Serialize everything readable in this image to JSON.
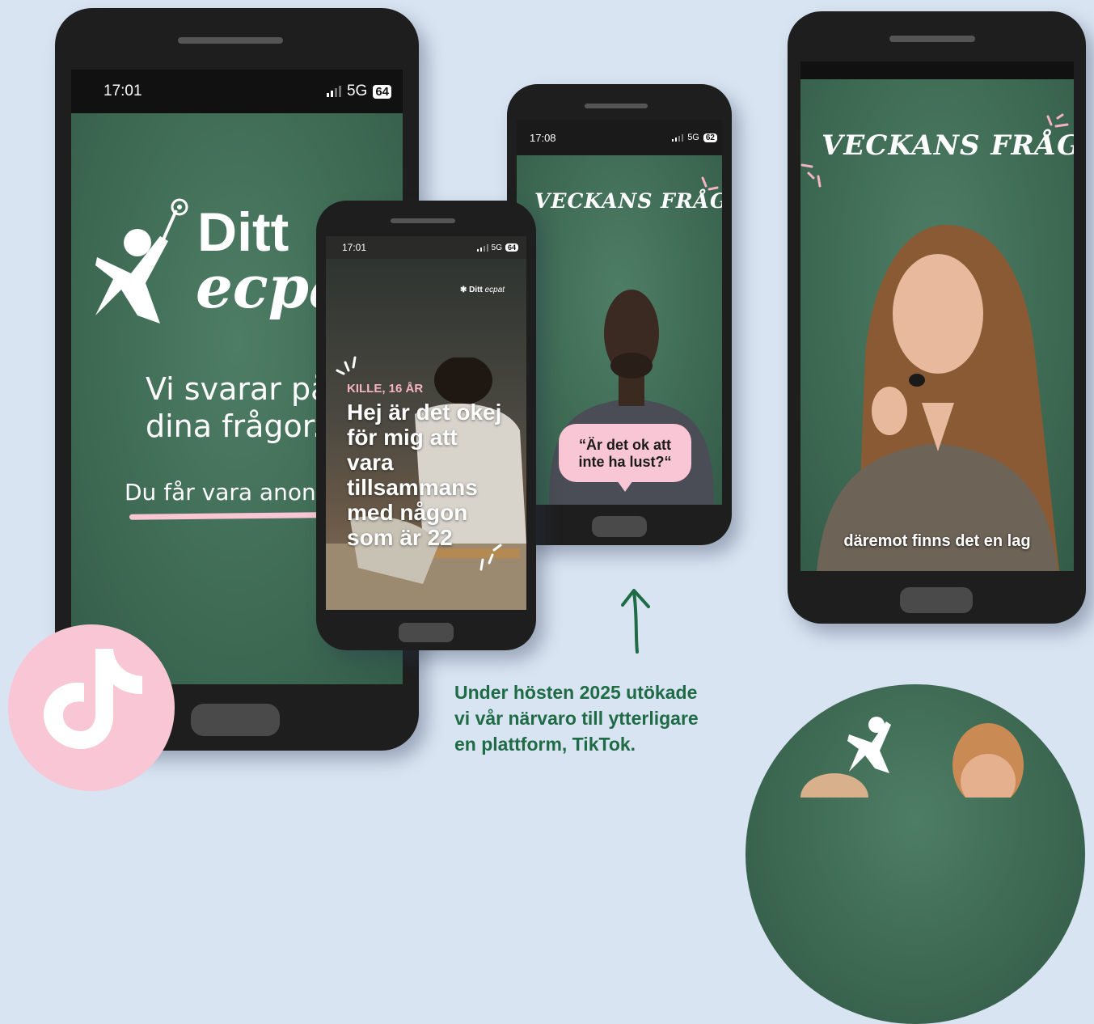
{
  "phone1": {
    "time": "17:01",
    "network": "5G",
    "battery": "64",
    "logo_word1": "Ditt",
    "logo_word2": "ecpat",
    "tagline_line1": "Vi svarar på",
    "tagline_line2": "dina frågor.",
    "anon_text": "Du får vara anonym"
  },
  "phone2": {
    "time": "17:01",
    "network": "5G",
    "battery": "64",
    "logo_word1": "Ditt",
    "logo_word2": "ecpat",
    "kicker": "KILLE, 16 ÅR",
    "headline_lines": [
      "Hej är det okej",
      "för mig att",
      "vara",
      "tillsammans",
      "med någon",
      "som är 22"
    ]
  },
  "phone3": {
    "time": "17:08",
    "network": "5G",
    "battery": "62",
    "title": "VECKANS FRÅGA",
    "bubble_line1": "“Är det ok att",
    "bubble_line2": "inte ha lust?“"
  },
  "phone4": {
    "title": "VECKANS FRÅGA",
    "subtitle": "däremot finns det en lag"
  },
  "caption_lines": [
    "Under hösten 2025 utökade",
    "vi vår närvaro till ytterligare",
    "en plattform, TikTok."
  ],
  "colors": {
    "page_bg": "#d9e4f2",
    "accent_green": "#1e6b45",
    "accent_pink": "#f8c6d4",
    "screen_green": "#3f6b55"
  },
  "icons": {
    "tiktok": "tiktok-logo-icon",
    "arrow": "up-arrow-icon"
  }
}
